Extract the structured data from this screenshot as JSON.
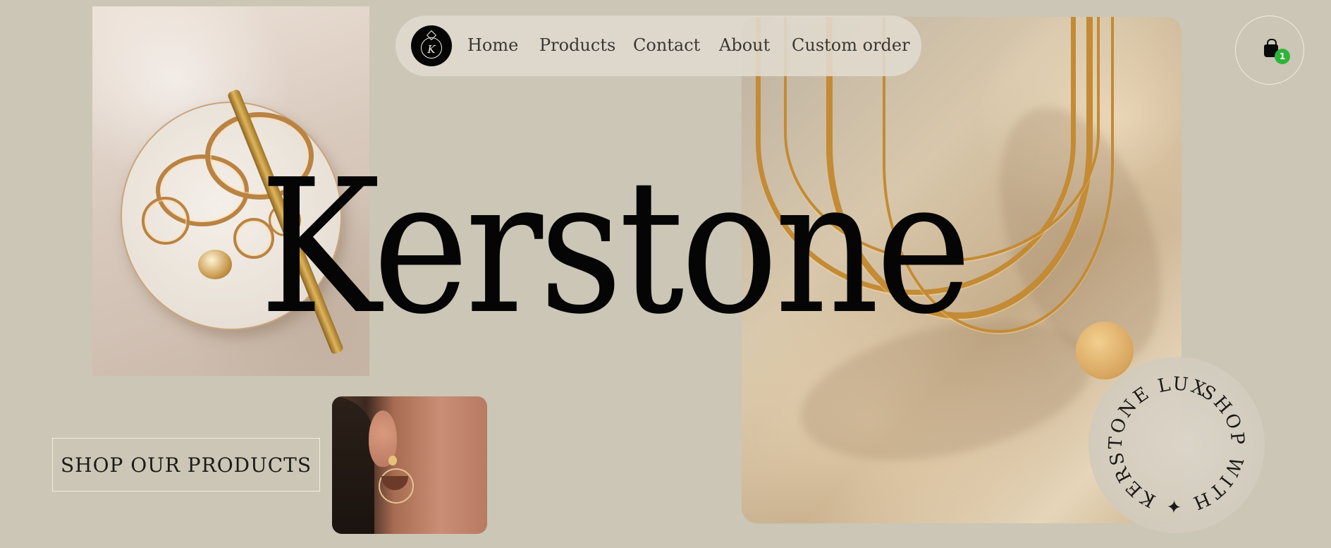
{
  "nav": {
    "logo_letter": "K",
    "items": [
      {
        "label": "Home"
      },
      {
        "label": "Products"
      },
      {
        "label": "Contact"
      },
      {
        "label": "About"
      },
      {
        "label": "Custom order"
      }
    ]
  },
  "hero": {
    "title": "Kerstone"
  },
  "cta": {
    "shop_label": "SHOP OUR PRODUCTS"
  },
  "cart": {
    "icon": "shopping-bag-icon",
    "count": "1",
    "badge_color": "#2fb43a"
  },
  "badge": {
    "circular_text": "SHOP WITH ✦ KERSTONE LUXE ✦"
  },
  "colors": {
    "background": "#cbc6b6",
    "title": "#050505",
    "nav_pill": "#e0dbcf"
  }
}
